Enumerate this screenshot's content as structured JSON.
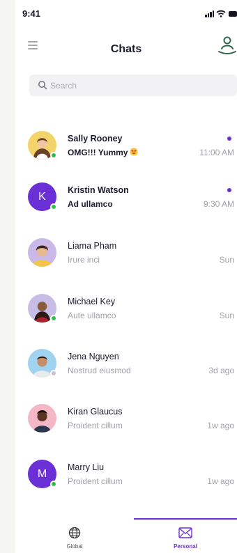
{
  "status_bar": {
    "time": "9:41"
  },
  "header": {
    "title": "Chats"
  },
  "search": {
    "placeholder": "Search"
  },
  "colors": {
    "accent": "#6b2fd6",
    "online": "#2fbf4a",
    "offline": "#c4c4c8"
  },
  "chats": [
    {
      "name": "Sally Rooney",
      "message": "OMG!!! Yummy",
      "emoji": "smiling-face-with-heart-eyes",
      "time": "11:00 AM",
      "unread": true,
      "online": true
    },
    {
      "name": "Kristin Watson",
      "message": "Ad ullamco",
      "time": "9:30 AM",
      "unread": true,
      "online": true,
      "initial": "K"
    },
    {
      "name": "Liama Pham",
      "message": "Irure inci",
      "time": "Sun",
      "unread": false,
      "online": false
    },
    {
      "name": "Michael Key",
      "message": "Aute ullamco",
      "time": "Sun",
      "unread": false,
      "online": true
    },
    {
      "name": "Jena Nguyen",
      "message": "Nostrud eiusmod",
      "time": "3d ago",
      "unread": false,
      "online": false
    },
    {
      "name": "Kiran Glaucus",
      "message": "Proident cillum",
      "time": "1w ago",
      "unread": false,
      "online": false
    },
    {
      "name": "Marry Liu",
      "message": "Proident cillum",
      "time": "1w ago",
      "unread": false,
      "online": true,
      "initial": "M"
    }
  ],
  "bottom_nav": {
    "tabs": [
      {
        "label": "Global",
        "icon": "globe-icon",
        "active": false
      },
      {
        "label": "Personal",
        "icon": "mail-icon",
        "active": true
      }
    ]
  }
}
